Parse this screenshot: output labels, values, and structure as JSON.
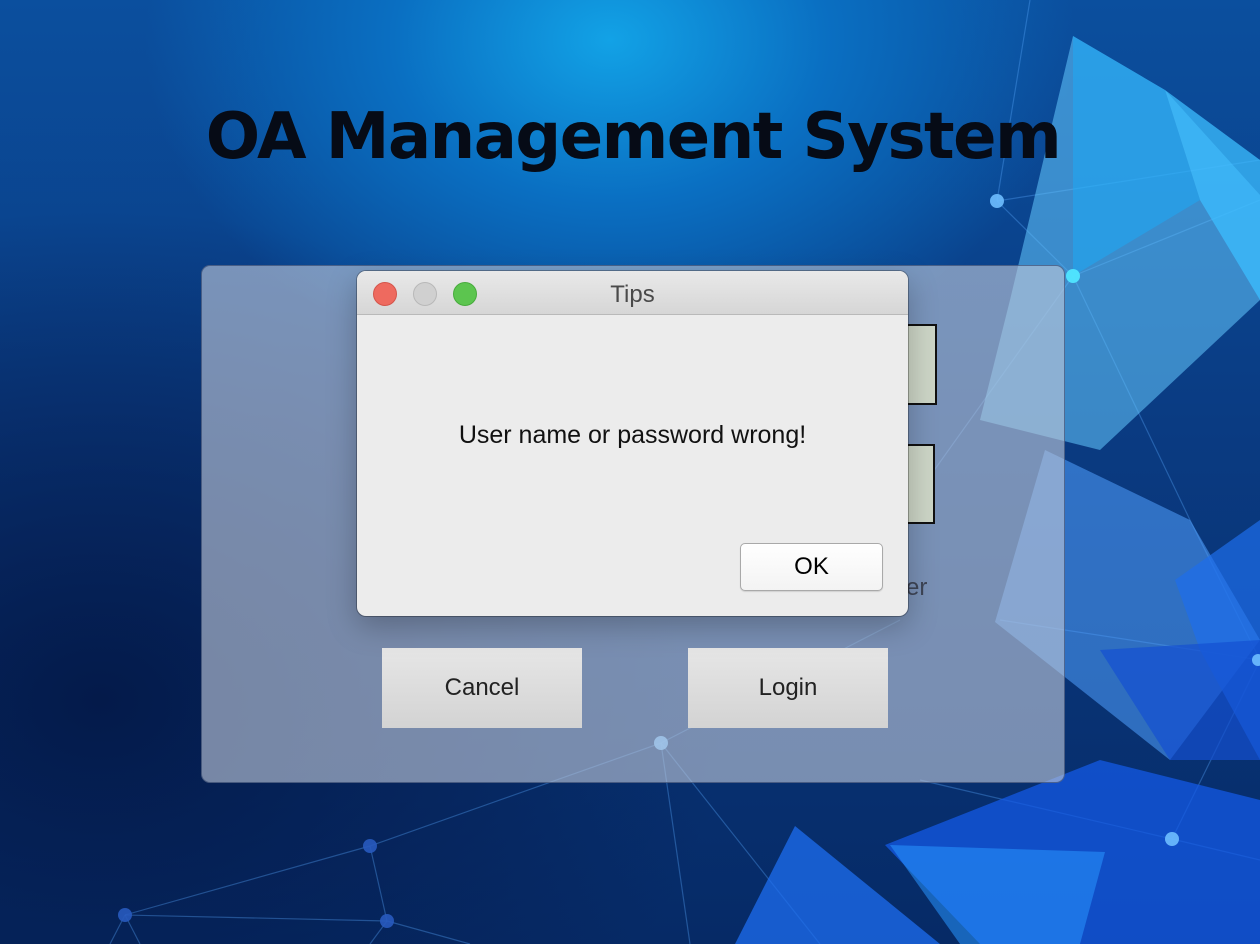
{
  "app": {
    "title": "OA Management System"
  },
  "login_panel": {
    "remember_fragment": "er",
    "cancel_label": "Cancel",
    "login_label": "Login"
  },
  "dialog": {
    "title": "Tips",
    "message": "User name or password wrong!",
    "ok_label": "OK"
  },
  "colors": {
    "background_top": "#12a2e6",
    "background_bottom": "#062a66",
    "close_button": "#ee6a5f",
    "minimize_button": "#d0d0d0",
    "maximize_button": "#5cc54f",
    "dialog_background": "#ececec"
  }
}
